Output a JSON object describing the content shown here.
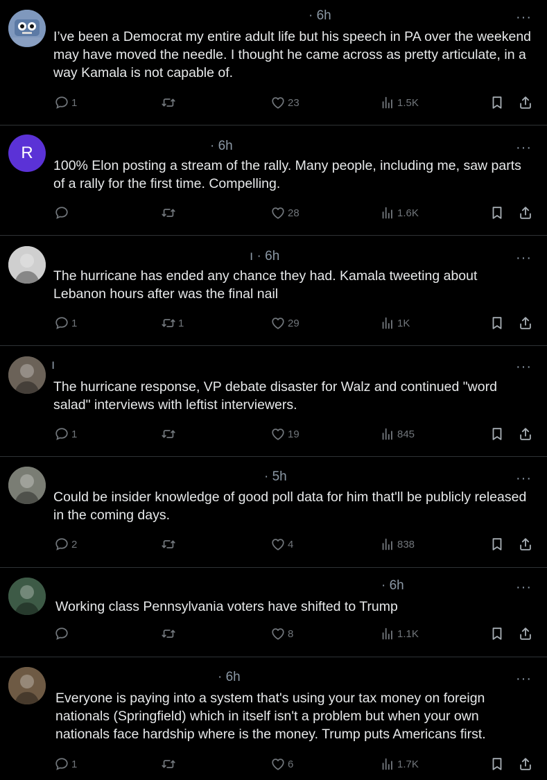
{
  "tweets": [
    {
      "time": "· 6h",
      "text": "I’ve been a Democrat my entire adult life but his speech in PA over the weekend may have moved the needle.  I thought he came across as pretty articulate, in a way Kamala is not capable of.",
      "replies": "1",
      "reposts": "",
      "likes": "23",
      "views": "1.5K",
      "avatar": {
        "kind": "robot-avatar",
        "bg": "#6f86a8"
      }
    },
    {
      "time": "· 6h",
      "text": "100% Elon posting a stream of the rally. Many people, including me, saw parts of a rally for the first time. Compelling.",
      "replies": "",
      "reposts": "",
      "likes": "28",
      "views": "1.6K",
      "avatar": {
        "kind": "letter-avatar",
        "letter": "R",
        "bg": "#5b32d6"
      }
    },
    {
      "time": "ı · 6h",
      "text": "The hurricane has ended any chance they had. Kamala tweeting about Lebanon hours after was the final nail",
      "replies": "1",
      "reposts": "1",
      "likes": "29",
      "views": "1K",
      "avatar": {
        "kind": "photo-avatar",
        "bg": "#cfcfcf"
      }
    },
    {
      "time": "ı",
      "text": "The hurricane response, VP debate disaster for Walz and continued \"word salad\" interviews with leftist interviewers.",
      "replies": "1",
      "reposts": "",
      "likes": "19",
      "views": "845",
      "avatar": {
        "kind": "photo-avatar",
        "bg": "#6b6258"
      }
    },
    {
      "time": "· 5h",
      "text": "Could be insider knowledge of good poll data for him that'll be publicly released in the coming days.",
      "replies": "2",
      "reposts": "",
      "likes": "4",
      "views": "838",
      "avatar": {
        "kind": "photo-avatar",
        "bg": "#7a7d74"
      }
    },
    {
      "time": "· 6h",
      "text": "Working class Pennsylvania voters have shifted to Trump",
      "replies": "",
      "reposts": "",
      "likes": "8",
      "views": "1.1K",
      "avatar": {
        "kind": "photo-avatar",
        "bg": "#3d5a46"
      }
    },
    {
      "time": "· 6h",
      "text": "Everyone is paying into a system that's using your tax money on foreign nationals (Springfield) which in itself isn't a problem but when your own nationals face hardship where is the money. Trump puts Americans first.",
      "replies": "1",
      "reposts": "",
      "likes": "6",
      "views": "1.7K",
      "avatar": {
        "kind": "photo-avatar",
        "bg": "#6e5a44"
      }
    }
  ],
  "more_label": "···",
  "colors": {
    "background": "#000000",
    "text": "#e7e9ea",
    "muted": "#71767b",
    "divider": "#2f3336"
  }
}
